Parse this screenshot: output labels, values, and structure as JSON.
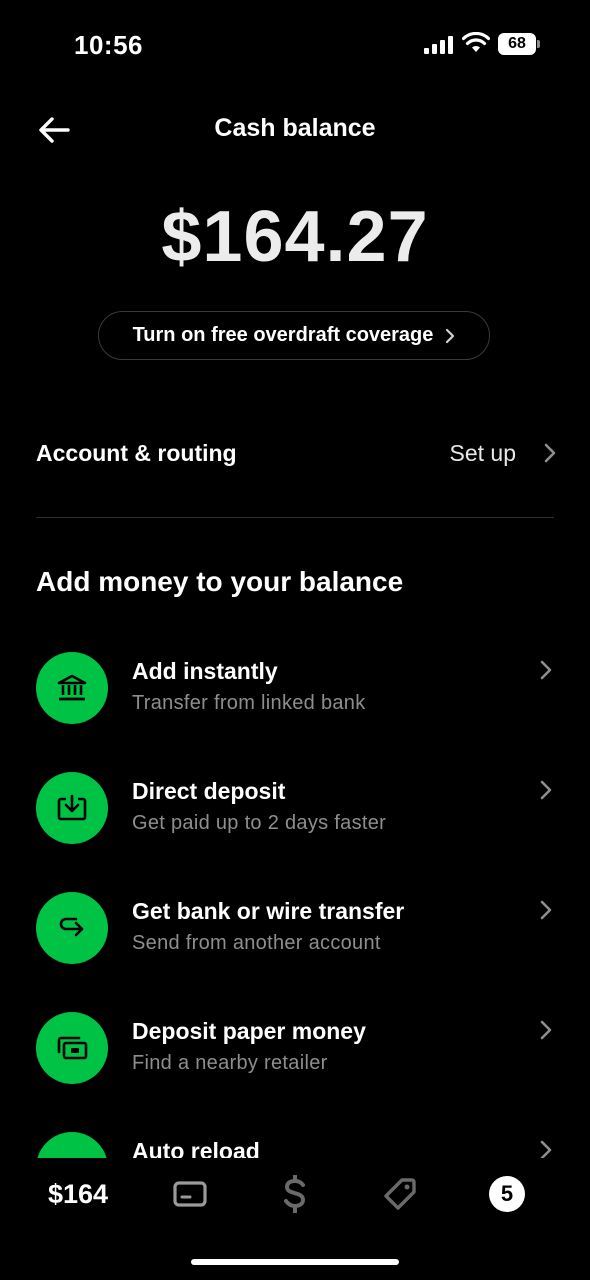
{
  "status_bar": {
    "time": "10:56",
    "battery": "68"
  },
  "header": {
    "title": "Cash balance"
  },
  "balance": {
    "amount": "$164.27"
  },
  "overdraft": {
    "label": "Turn on free overdraft coverage"
  },
  "account": {
    "label": "Account & routing",
    "action": "Set up"
  },
  "section": {
    "title": "Add money to your balance"
  },
  "add_money_items": [
    {
      "title": "Add instantly",
      "subtitle": "Transfer from linked bank",
      "icon": "bank-icon"
    },
    {
      "title": "Direct deposit",
      "subtitle": "Get paid up to 2 days faster",
      "icon": "deposit-icon"
    },
    {
      "title": "Get bank or wire transfer",
      "subtitle": "Send from another account",
      "icon": "transfer-icon"
    },
    {
      "title": "Deposit paper money",
      "subtitle": "Find a nearby retailer",
      "icon": "cash-icon"
    },
    {
      "title": "Auto reload",
      "subtitle": "",
      "icon": "reload-icon"
    }
  ],
  "tab_bar": {
    "balance_label": "$164",
    "tabs": [
      "card-icon",
      "dollar-icon",
      "tag-icon"
    ],
    "activity_badge": "5"
  },
  "colors": {
    "accent": "#00c244",
    "background": "#000000",
    "muted_text": "#8e8e8e"
  }
}
